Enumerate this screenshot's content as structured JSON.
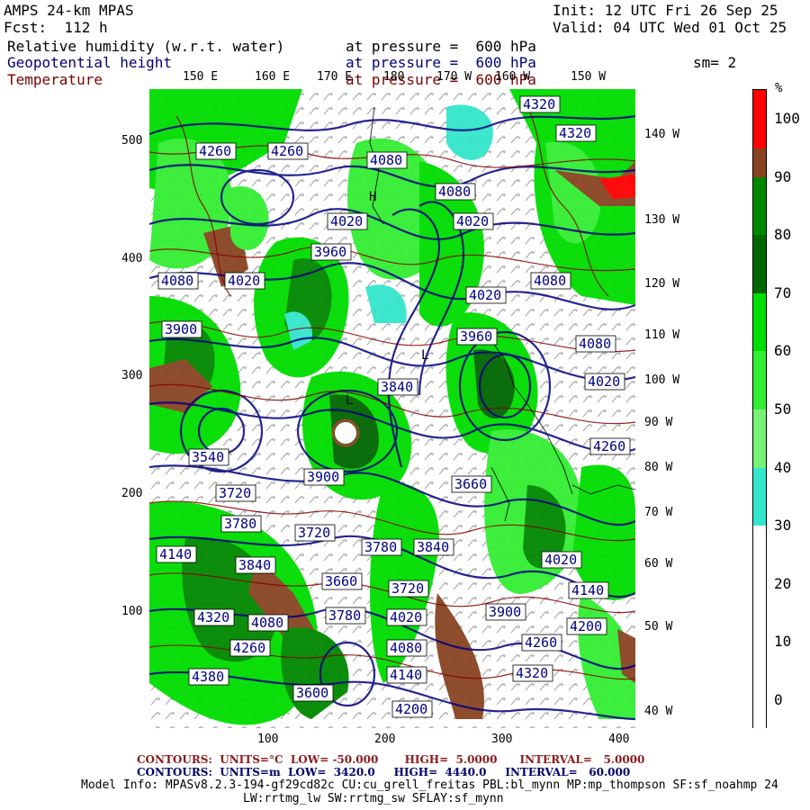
{
  "header": {
    "model": "AMPS 24-km MPAS",
    "init": "Init: 12 UTC Fri 26 Sep 25",
    "fcst": "Fcst:  112 h",
    "valid": "Valid: 04 UTC Wed 01 Oct 25",
    "fields": [
      {
        "name": "Relative humidity (w.r.t. water)",
        "level": "at pressure =  600 hPa"
      },
      {
        "name": "Geopotential height",
        "level": "at pressure =  600 hPa"
      },
      {
        "name": "Temperature",
        "level": "at pressure =  600 hPa"
      }
    ],
    "smooth": "sm= 2"
  },
  "colors": {
    "rh_light_cyan": "#33e6cc",
    "rh_lt_green": "#66ee66",
    "rh_green": "#00e600",
    "rh_mid_green": "#00bb00",
    "rh_dk_green": "#008800",
    "rh_darker_green": "#006600",
    "rh_brown": "#884422",
    "rh_red": "#ff0000",
    "height_contour": "#000080",
    "temp_contour": "#880000"
  },
  "map": {
    "top_lon_labels": [
      "150 E",
      "160 E",
      "170 E",
      "180",
      "170 W",
      "160 W",
      "150 W"
    ],
    "right_lon_labels": [
      "140 W",
      "130 W",
      "120 W",
      "110 W",
      "100 W",
      "90 W",
      "80 W",
      "70 W",
      "60 W",
      "50 W",
      "40 W"
    ],
    "x_ticks": [
      "100",
      "200",
      "300",
      "400"
    ],
    "y_ticks": [
      "500",
      "400",
      "300",
      "200",
      "100"
    ],
    "height_labels": [
      "4260",
      "4200",
      "4080",
      "4020",
      "3960",
      "3900",
      "3840",
      "3780",
      "3720",
      "3660",
      "4320",
      "4140",
      "4380",
      "3600",
      "3540"
    ],
    "markers": [
      "L",
      "H"
    ]
  },
  "colorbar": {
    "unit": "%",
    "labels": [
      "100",
      "90",
      "80",
      "70",
      "60",
      "50",
      "40",
      "30",
      "20",
      "10",
      "0"
    ],
    "segments": [
      {
        "from": 95,
        "to": 100,
        "color": "#ff0000"
      },
      {
        "from": 90,
        "to": 95,
        "color": "#884422"
      },
      {
        "from": 80,
        "to": 90,
        "color": "#008800"
      },
      {
        "from": 70,
        "to": 80,
        "color": "#006600"
      },
      {
        "from": 60,
        "to": 70,
        "color": "#00dd00"
      },
      {
        "from": 50,
        "to": 60,
        "color": "#33ee33"
      },
      {
        "from": 40,
        "to": 50,
        "color": "#77f077"
      },
      {
        "from": 30,
        "to": 40,
        "color": "#33e6cc"
      },
      {
        "from": 0,
        "to": 30,
        "color": "#ffffff"
      }
    ]
  },
  "footer": {
    "temp_contours": "CONTOURS:  UNITS=°C  LOW= -50.000       HIGH=  5.0000      INTERVAL=   5.0000",
    "height_contours": "CONTOURS:  UNITS=m  LOW=  3420.0     HIGH=  4440.0     INTERVAL=   60.000",
    "model_info": "Model Info: MPASv8.2.3-194-gf29cd82c CU:cu_grell_freitas PBL:bl_mynn MP:mp_thompson SF:sf_noahmp 24",
    "model_info2": "LW:rrtmg_lw SW:rrtmg_sw SFLAY:sf_mynn"
  }
}
